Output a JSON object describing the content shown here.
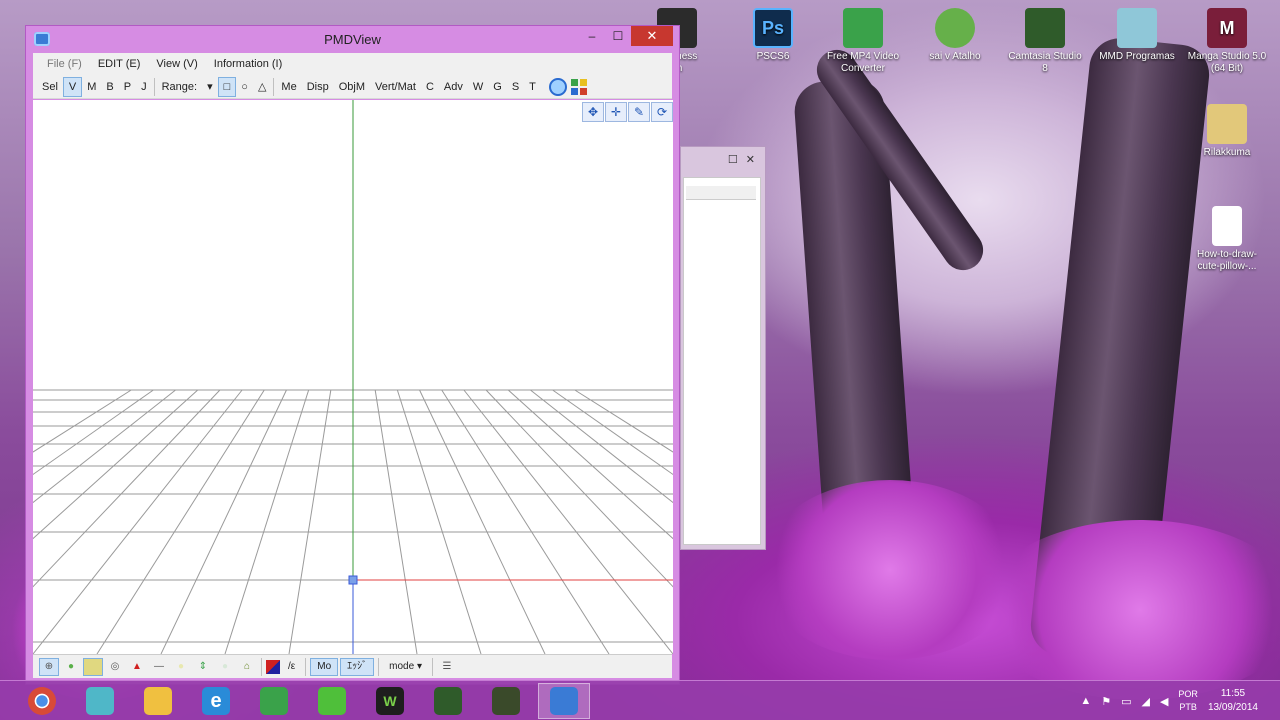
{
  "window": {
    "title": "PMDView",
    "minimize_glyph": "–",
    "maximize_glyph": "☐",
    "close_glyph": "✕"
  },
  "menubar": {
    "items": [
      {
        "label": "File (F)",
        "disabled": true
      },
      {
        "label": "EDIT (E)",
        "disabled": false
      },
      {
        "label": "View (V)",
        "disabled": false
      },
      {
        "label": "Information (I)",
        "disabled": false
      }
    ]
  },
  "toolbar": {
    "sel": "Sel",
    "v": "V",
    "m": "M",
    "b": "B",
    "p": "P",
    "j": "J",
    "range": "Range:",
    "range_arrow": "▾",
    "rect": "□",
    "circle": "○",
    "tri": "△",
    "me": "Me",
    "disp": "Disp",
    "objm": "ObjM",
    "vertmat": "Vert/Mat",
    "c": "C",
    "adv": "Adv",
    "w": "W",
    "g": "G",
    "s": "S",
    "t": "T"
  },
  "view_tools": {
    "move": "✥",
    "pan": "✛",
    "pen": "✎",
    "rotate": "⟳"
  },
  "statusbar": {
    "mode_label": "mode",
    "mode_arrow": "▾",
    "slash_a": "/ε",
    "mo_label": "Mo",
    "ek_label": "ｴｯｼﾞ"
  },
  "bg_dialog": {
    "max_glyph": "☐",
    "close_glyph": "✕"
  },
  "desktop_icons": [
    {
      "label": "Madness",
      "label2": "im",
      "color": "#2b2b2b",
      "letter": ""
    },
    {
      "label": "PSCS6",
      "label2": "",
      "color": "#0f2c4d",
      "letter": "Ps"
    },
    {
      "label": "Free MP4 Video",
      "label2": "Converter",
      "color": "#3aa24a",
      "letter": ""
    },
    {
      "label": "sai v Atalho",
      "label2": "",
      "color": "#66b04a",
      "letter": ""
    },
    {
      "label": "Camtasia Studio",
      "label2": "8",
      "color": "#2f5b2a",
      "letter": ""
    },
    {
      "label": "MMD Programas",
      "label2": "",
      "color": "#8fc7d8",
      "letter": ""
    },
    {
      "label": "Manga Studio 5.0",
      "label2": "(64 Bit)",
      "color": "#7a1e3a",
      "letter": "M"
    },
    {
      "label": "Rilakkuma",
      "label2": "",
      "color": "#e2c87a",
      "letter": ""
    },
    {
      "label": "How-to-draw-",
      "label2": "cute-pillow-...",
      "color": "#ffffff",
      "letter": ""
    }
  ],
  "taskbar": {
    "apps": [
      {
        "name": "chrome",
        "color": "#d84a38",
        "letter": ""
      },
      {
        "name": "miku",
        "color": "#4fb7c8",
        "letter": ""
      },
      {
        "name": "explorer",
        "color": "#f0c040",
        "letter": ""
      },
      {
        "name": "ie",
        "color": "#2a8bd8",
        "letter": "e"
      },
      {
        "name": "leaf1",
        "color": "#3aa24a",
        "letter": ""
      },
      {
        "name": "leaf2",
        "color": "#4fbf3a",
        "letter": ""
      },
      {
        "name": "w",
        "color": "#3a9a2a",
        "letter": "W"
      },
      {
        "name": "camtasia1",
        "color": "#2f5b2a",
        "letter": ""
      },
      {
        "name": "camtasia2",
        "color": "#3a4a2a",
        "letter": ""
      },
      {
        "name": "pmdview",
        "color": "#3a7bd5",
        "letter": ""
      }
    ],
    "lang_line1": "POR",
    "lang_line2": "PTB",
    "time": "11:55",
    "date": "13/09/2014",
    "tray_up": "▲",
    "tray_flag": "⚑",
    "tray_battery": "▭",
    "tray_net": "◢",
    "tray_sound": "◀"
  }
}
